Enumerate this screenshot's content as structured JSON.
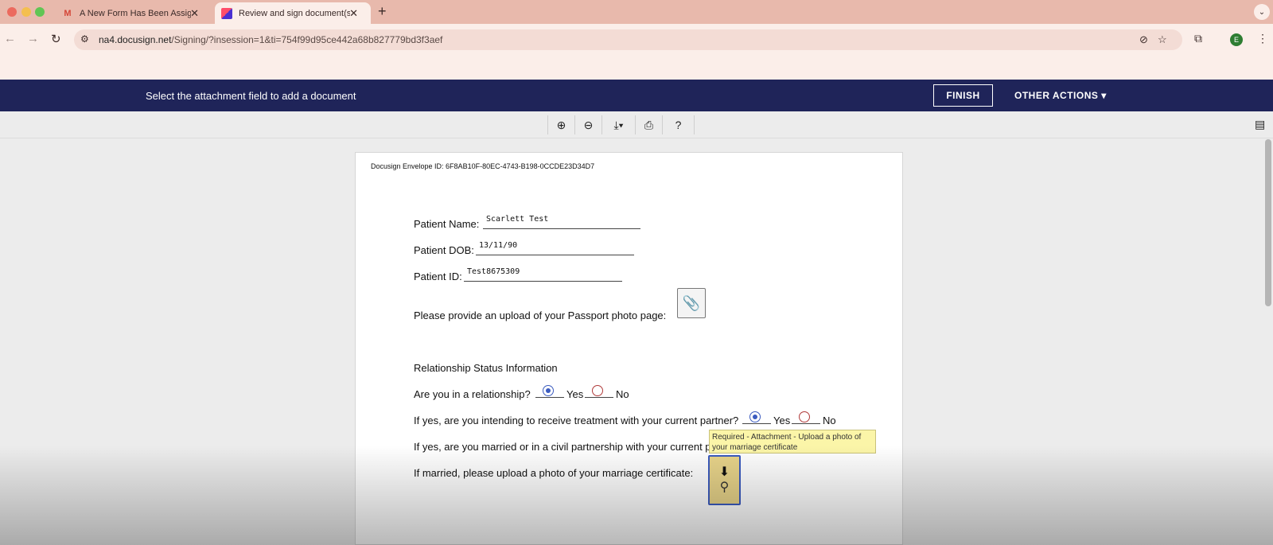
{
  "browser": {
    "tabs": [
      {
        "title": "A New Form Has Been Assigned",
        "favicon": "gmail-icon"
      },
      {
        "title": "Review and sign document(s)",
        "favicon": "docusign-icon"
      }
    ],
    "url_host": "na4.docusign.net",
    "url_path": "/Signing/?insession=1&ti=754f99d95ce442a68b827779bd3f3aef",
    "profile_initial": "E"
  },
  "docusign": {
    "instruction": "Select the attachment field to add a document",
    "finish_label": "FINISH",
    "other_actions_label": "OTHER ACTIONS"
  },
  "document": {
    "envelope_id": "Docusign Envelope ID: 6F8AB10F-80EC-4743-B198-0CCDE23D34D7",
    "patient_name_label": "Patient Name:",
    "patient_name_value": "Scarlett Test",
    "patient_dob_label": "Patient DOB:",
    "patient_dob_value": "13/11/90",
    "patient_id_label": "Patient ID:",
    "patient_id_value": "Test8675309",
    "passport_label": "Please provide an upload of your Passport photo page:",
    "relationship_heading": "Relationship Status Information",
    "q1_label": "Are you in a relationship?",
    "q2_label": "If yes, are you intending to receive treatment with your current partner?",
    "q3_label": "If yes, are you married or in a civil partnership with your current p",
    "q4_label": "If married, please upload a photo of your marriage certificate:",
    "yes_label": "Yes",
    "no_label": "No",
    "tooltip_text": "Required - Attachment - Upload a photo of your marriage certificate"
  },
  "colors": {
    "docusign_bar": "#1f2459",
    "tab_strip": "#e8b9ac",
    "required_field": "#e8d48a",
    "radio_selected": "#3b5bbf"
  }
}
